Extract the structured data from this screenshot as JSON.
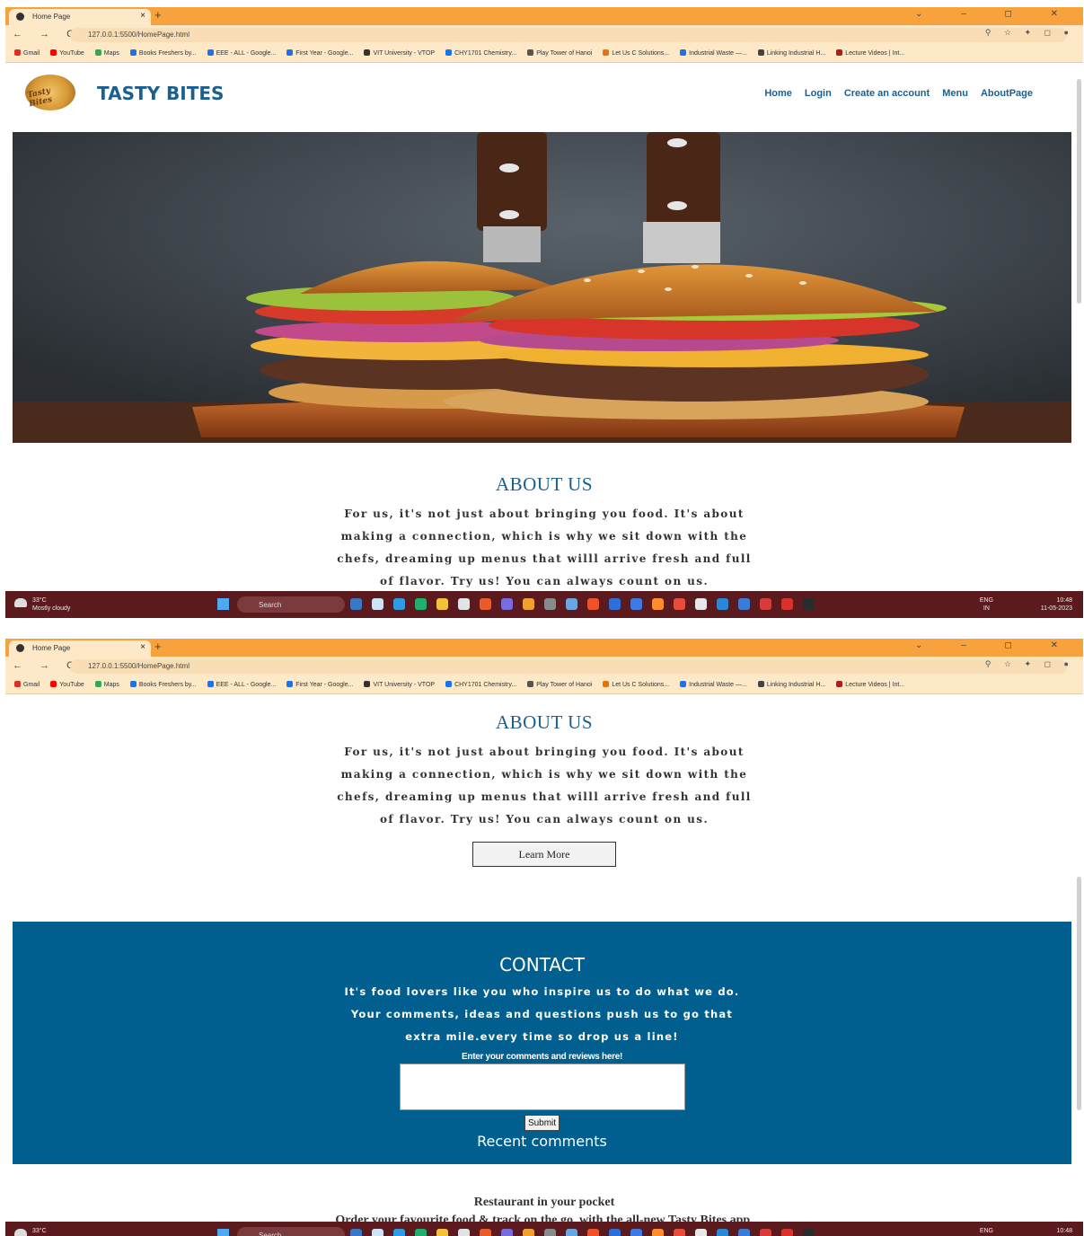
{
  "browser": {
    "tab_title": "Home Page",
    "new_tab": "+",
    "url": "127.0.0.1:5500/HomePage.html",
    "window_controls": "⌄ – ◻ ✕",
    "bookmarks": [
      {
        "label": "Gmail",
        "color": "#d93025"
      },
      {
        "label": "YouTube",
        "color": "#ff0000"
      },
      {
        "label": "Maps",
        "color": "#34a853"
      },
      {
        "label": "Books Freshers by...",
        "color": "#1a73e8"
      },
      {
        "label": "EEE - ALL - Google...",
        "color": "#1a73e8"
      },
      {
        "label": "First Year - Google...",
        "color": "#1a73e8"
      },
      {
        "label": "VIT University - VTOP",
        "color": "#333333"
      },
      {
        "label": "CHY1701 Chemistry...",
        "color": "#1a73e8"
      },
      {
        "label": "Play Tower of Hanoi",
        "color": "#555555"
      },
      {
        "label": "Let Us C Solutions...",
        "color": "#e8710a"
      },
      {
        "label": "Industrial Waste —...",
        "color": "#1a73e8"
      },
      {
        "label": "Linking Industrial H...",
        "color": "#444444"
      },
      {
        "label": "Lecture Videos | Int...",
        "color": "#b31b1b"
      }
    ]
  },
  "site": {
    "logo_text": "Tasty Bites",
    "brand": "TASTY BITES",
    "nav": [
      "Home",
      "Login",
      "Create an account",
      "Menu",
      "AboutPage"
    ]
  },
  "about": {
    "title": "ABOUT US",
    "text": "For us, it's not just about bringing you food. It's about making a connection, which is why we sit down with the chefs, dreaming up menus that willl arrive fresh and full of flavor. Try us! You can always count on us.",
    "button": "Learn More"
  },
  "contact": {
    "title": "CONTACT",
    "text": "It's food lovers like you who inspire us to do what we do. Your comments, ideas and questions push us to go that extra mile.every time so drop us a line!",
    "label": "Enter your comments and reviews here!",
    "submit": "Submit",
    "recent": "Recent comments"
  },
  "pocket": {
    "title": "Restaurant in your pocket",
    "text": "Order your favourite food & track on the go, with the all-new Tasty Bites app."
  },
  "taskbar": {
    "temperature": "33°C",
    "weather": "Mostly cloudy",
    "search": "Search",
    "lang": "ENG",
    "region": "IN",
    "time": "10:48",
    "date": "11-05-2023",
    "app_colors": [
      "#3a78c4",
      "#cfe3f5",
      "#2f9be3",
      "#1fb06f",
      "#f3c13a",
      "#e3e3e3",
      "#e85b2a",
      "#7b6be0",
      "#f0a030",
      "#8a8a8a",
      "#6aa6e0",
      "#f0502a",
      "#2d6fd6",
      "#3f7ae0",
      "#ff8c2e",
      "#e84c3d",
      "#e8e8e8",
      "#2b88d8",
      "#3c7bd8",
      "#d83b3b",
      "#d8322b",
      "#2b2b2b"
    ]
  }
}
